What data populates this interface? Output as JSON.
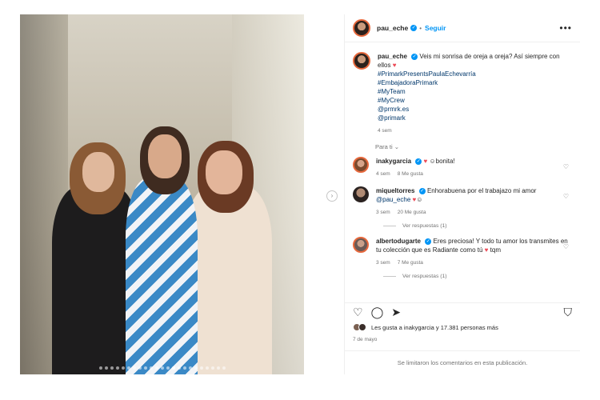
{
  "post": {
    "author": "pau_eche",
    "follow_label": "Seguir",
    "more_icon": "more-horizontal-icon",
    "caption": {
      "text": "Veis mi sonrisa de oreja a oreja? Así siempre con ellos",
      "hashtags": [
        "#PrimarkPresentsPaulaEchevarría",
        "#EmbajadoraPrimark",
        "#MyTeam",
        "#MyCrew",
        "@prmrk.es",
        "@primark"
      ],
      "time": "4 sem"
    },
    "para_ti": "Para ti"
  },
  "comments": [
    {
      "user": "inakygarcia",
      "text": "bonita!",
      "time": "4 sem",
      "likes": "8 Me gusta"
    },
    {
      "user": "miqueltorres",
      "text": "Enhorabuena por el trabajazo mi amor",
      "mention": "@pau_eche",
      "time": "3 sem",
      "likes": "20 Me gusta",
      "replies": "Ver respuestas (1)"
    },
    {
      "user": "albertodugarte",
      "text": "Eres preciosa! Y todo tu amor los transmites en tu colección que es Radiante como tú",
      "text_end": "tqm",
      "time": "3 sem",
      "likes": "7 Me gusta",
      "replies": "Ver respuestas (1)"
    }
  ],
  "footer": {
    "likes_text": "Les gusta a inakygarcia y 17.381 personas más",
    "date": "7 de mayo",
    "limited_text": "Se limitaron los comentarios en esta publicación."
  },
  "colors": {
    "link": "#0095f6",
    "hashtag": "#00376b",
    "heart": "#ed4956"
  }
}
